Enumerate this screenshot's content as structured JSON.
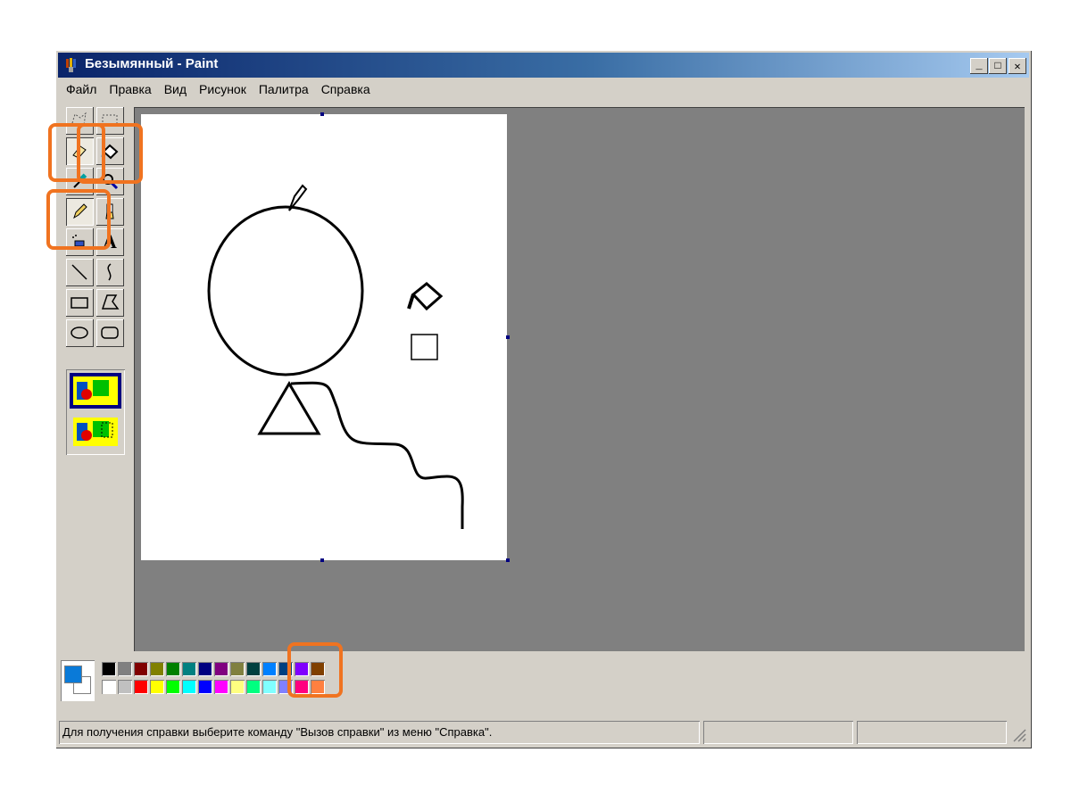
{
  "window": {
    "title": "Безымянный - Paint"
  },
  "title_buttons": {
    "minimize": "_",
    "maximize": "□",
    "close": "✕"
  },
  "menu": [
    "Файл",
    "Правка",
    "Вид",
    "Рисунок",
    "Палитра",
    "Справка"
  ],
  "tools": [
    {
      "name": "free-select",
      "icon": "free-select-icon"
    },
    {
      "name": "rect-select",
      "icon": "rect-select-icon"
    },
    {
      "name": "eraser",
      "icon": "eraser-icon"
    },
    {
      "name": "fill",
      "icon": "paint-bucket-icon"
    },
    {
      "name": "color-picker",
      "icon": "eyedropper-icon"
    },
    {
      "name": "magnifier",
      "icon": "magnifier-icon"
    },
    {
      "name": "pencil",
      "icon": "pencil-icon",
      "selected": true
    },
    {
      "name": "brush",
      "icon": "brush-icon"
    },
    {
      "name": "airbrush",
      "icon": "airbrush-icon"
    },
    {
      "name": "text",
      "icon": "text-icon",
      "label": "A"
    },
    {
      "name": "line",
      "icon": "line-icon"
    },
    {
      "name": "curve",
      "icon": "curve-icon"
    },
    {
      "name": "rectangle",
      "icon": "rectangle-icon"
    },
    {
      "name": "polygon",
      "icon": "polygon-icon"
    },
    {
      "name": "ellipse",
      "icon": "ellipse-icon"
    },
    {
      "name": "rounded-rect",
      "icon": "rounded-rect-icon"
    }
  ],
  "palette": {
    "foreground": "#0a7ad8",
    "background": "#ffffff",
    "top_row": [
      "#000000",
      "#808080",
      "#800000",
      "#808000",
      "#008000",
      "#008080",
      "#000080",
      "#800080",
      "#808040",
      "#004040",
      "#0080ff",
      "#004080",
      "#8000ff",
      "#804000"
    ],
    "bottom_row": [
      "#ffffff",
      "#c0c0c0",
      "#ff0000",
      "#ffff00",
      "#00ff00",
      "#00ffff",
      "#0000ff",
      "#ff00ff",
      "#ffff80",
      "#00ff80",
      "#80ffff",
      "#8080ff",
      "#ff0080",
      "#ff8040"
    ]
  },
  "status": {
    "text": "Для получения справки выберите команду \"Вызов справки\" из меню \"Справка\"."
  },
  "accent": "#f07320"
}
